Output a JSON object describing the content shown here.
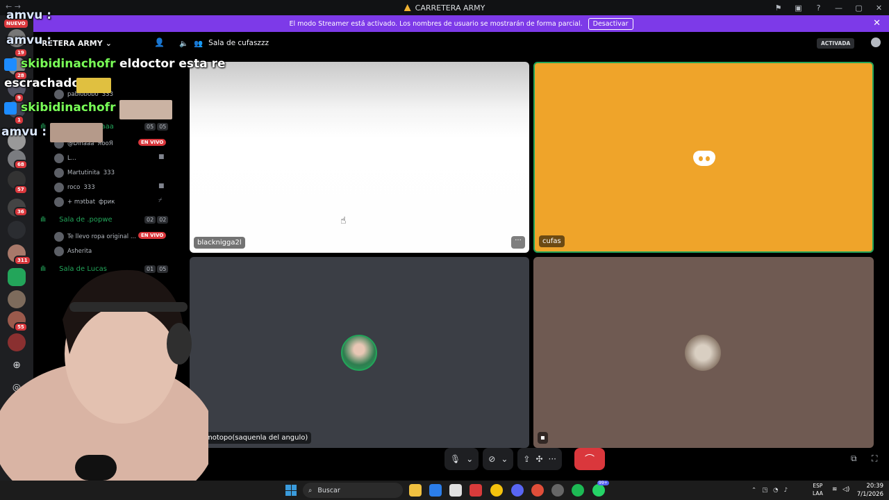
{
  "window": {
    "title": "CARRETERA ARMY",
    "controls": [
      "—",
      "▢",
      "✕"
    ]
  },
  "banner": {
    "text": "El modo Streamer está activado. Los nombres de usuario se mostrarán de forma parcial.",
    "button": "Desactivar"
  },
  "rail": {
    "new_badge": "NUEVO",
    "badges": [
      "19",
      "28",
      "9",
      "1",
      "68",
      "57",
      "36",
      "311",
      "55"
    ]
  },
  "server": {
    "name": "RETERA ARMY"
  },
  "channels": [
    {
      "name": "naaa",
      "count_a": "05",
      "count_b": "05"
    },
    {
      "name": "Sala de .popwe",
      "count_a": "02",
      "count_b": "02"
    },
    {
      "name": "Sala de Lucas",
      "count_a": "01",
      "count_b": "05"
    }
  ],
  "members": [
    {
      "name": "pablobobo",
      "tag": "333"
    },
    {
      "name": "@Dinaaa",
      "tag": "ЯооЯ"
    },
    {
      "name": "L..."
    },
    {
      "name": "Martutinita",
      "tag": "333"
    },
    {
      "name": "roco",
      "tag": "333"
    },
    {
      "name": "+ mэtbat",
      "tag": "фрик"
    },
    {
      "name": "Te llevo ropa original ..."
    },
    {
      "name": "Asherita"
    }
  ],
  "live_label": "EN VIVO",
  "stage": {
    "channel": "Sala de cufaszzz",
    "activada": "ACTIVADA"
  },
  "tiles": {
    "t1": "blacknigga2l",
    "t2": "cufas",
    "t3": "motopo(saquenla del angulo)",
    "more": "···"
  },
  "controls": {
    "end_call": "⌒"
  },
  "overlay": {
    "line1_user": "amvu :",
    "line2_user": "amvu :",
    "line3_user": "skibidinachofr",
    "line3_msg": "eldoctor esta re",
    "line4": "escrachado",
    "line5_user": "skibidinachofr",
    "line6_user": "amvu :"
  },
  "taskbar": {
    "search": "Buscar",
    "lang1": "ESP",
    "lang2": "LAA",
    "time": "20:39",
    "date": "7/1/2026",
    "discord_badge": "99+"
  },
  "colors": {
    "accent": "#7d3ae8",
    "voice_green": "#23a55a",
    "danger": "#da373c",
    "tile_orange": "#efa42a"
  }
}
